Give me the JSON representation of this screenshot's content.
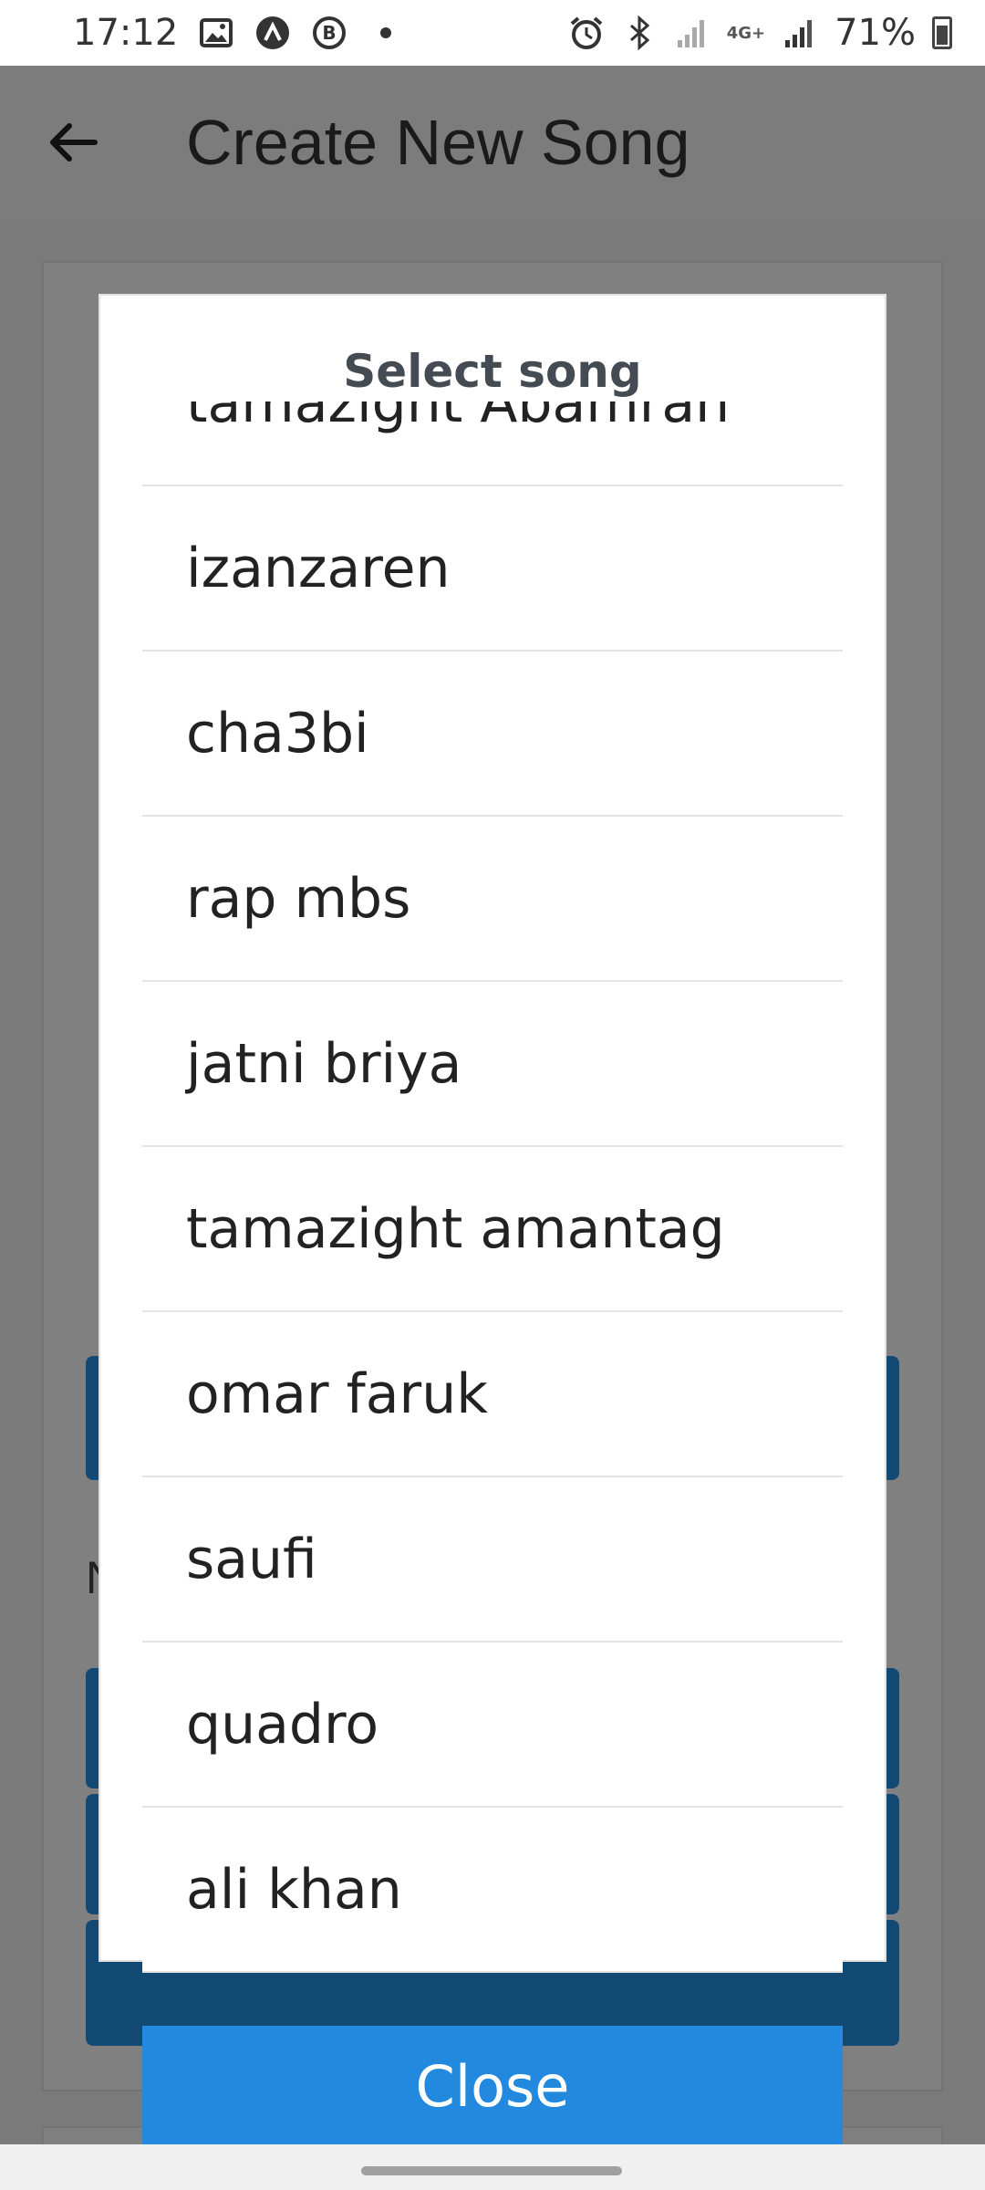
{
  "status_bar": {
    "time": "17:12",
    "network": "4G+",
    "battery": "71%"
  },
  "app_bar": {
    "title": "Create New Song"
  },
  "background": {
    "partial_letter": "N"
  },
  "dialog": {
    "title": "Select song",
    "songs": [
      "tamazight Abamran",
      "izanzaren",
      "cha3bi",
      "rap mbs",
      "jatni briya",
      "tamazight amantag",
      "omar faruk",
      "saufi",
      "quadro",
      "ali khan"
    ],
    "close_label": "Close"
  },
  "colors": {
    "accent": "#2289de",
    "dim_button": "#134a74",
    "overlay": "#7a7a7a"
  }
}
